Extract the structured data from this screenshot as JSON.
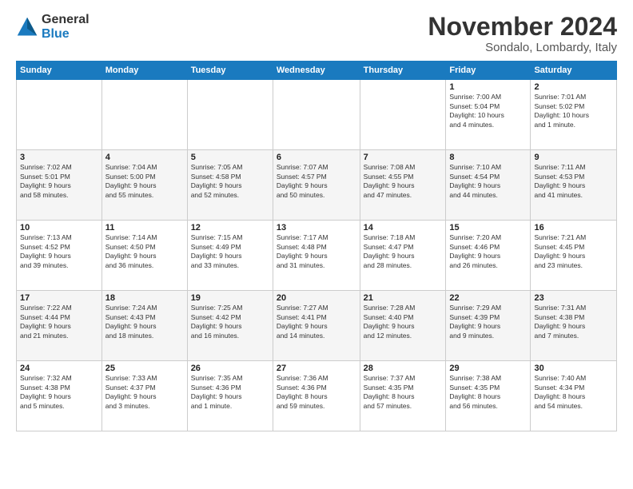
{
  "logo": {
    "general": "General",
    "blue": "Blue"
  },
  "title": "November 2024",
  "location": "Sondalo, Lombardy, Italy",
  "headers": [
    "Sunday",
    "Monday",
    "Tuesday",
    "Wednesday",
    "Thursday",
    "Friday",
    "Saturday"
  ],
  "weeks": [
    [
      {
        "day": "",
        "info": ""
      },
      {
        "day": "",
        "info": ""
      },
      {
        "day": "",
        "info": ""
      },
      {
        "day": "",
        "info": ""
      },
      {
        "day": "",
        "info": ""
      },
      {
        "day": "1",
        "info": "Sunrise: 7:00 AM\nSunset: 5:04 PM\nDaylight: 10 hours\nand 4 minutes."
      },
      {
        "day": "2",
        "info": "Sunrise: 7:01 AM\nSunset: 5:02 PM\nDaylight: 10 hours\nand 1 minute."
      }
    ],
    [
      {
        "day": "3",
        "info": "Sunrise: 7:02 AM\nSunset: 5:01 PM\nDaylight: 9 hours\nand 58 minutes."
      },
      {
        "day": "4",
        "info": "Sunrise: 7:04 AM\nSunset: 5:00 PM\nDaylight: 9 hours\nand 55 minutes."
      },
      {
        "day": "5",
        "info": "Sunrise: 7:05 AM\nSunset: 4:58 PM\nDaylight: 9 hours\nand 52 minutes."
      },
      {
        "day": "6",
        "info": "Sunrise: 7:07 AM\nSunset: 4:57 PM\nDaylight: 9 hours\nand 50 minutes."
      },
      {
        "day": "7",
        "info": "Sunrise: 7:08 AM\nSunset: 4:55 PM\nDaylight: 9 hours\nand 47 minutes."
      },
      {
        "day": "8",
        "info": "Sunrise: 7:10 AM\nSunset: 4:54 PM\nDaylight: 9 hours\nand 44 minutes."
      },
      {
        "day": "9",
        "info": "Sunrise: 7:11 AM\nSunset: 4:53 PM\nDaylight: 9 hours\nand 41 minutes."
      }
    ],
    [
      {
        "day": "10",
        "info": "Sunrise: 7:13 AM\nSunset: 4:52 PM\nDaylight: 9 hours\nand 39 minutes."
      },
      {
        "day": "11",
        "info": "Sunrise: 7:14 AM\nSunset: 4:50 PM\nDaylight: 9 hours\nand 36 minutes."
      },
      {
        "day": "12",
        "info": "Sunrise: 7:15 AM\nSunset: 4:49 PM\nDaylight: 9 hours\nand 33 minutes."
      },
      {
        "day": "13",
        "info": "Sunrise: 7:17 AM\nSunset: 4:48 PM\nDaylight: 9 hours\nand 31 minutes."
      },
      {
        "day": "14",
        "info": "Sunrise: 7:18 AM\nSunset: 4:47 PM\nDaylight: 9 hours\nand 28 minutes."
      },
      {
        "day": "15",
        "info": "Sunrise: 7:20 AM\nSunset: 4:46 PM\nDaylight: 9 hours\nand 26 minutes."
      },
      {
        "day": "16",
        "info": "Sunrise: 7:21 AM\nSunset: 4:45 PM\nDaylight: 9 hours\nand 23 minutes."
      }
    ],
    [
      {
        "day": "17",
        "info": "Sunrise: 7:22 AM\nSunset: 4:44 PM\nDaylight: 9 hours\nand 21 minutes."
      },
      {
        "day": "18",
        "info": "Sunrise: 7:24 AM\nSunset: 4:43 PM\nDaylight: 9 hours\nand 18 minutes."
      },
      {
        "day": "19",
        "info": "Sunrise: 7:25 AM\nSunset: 4:42 PM\nDaylight: 9 hours\nand 16 minutes."
      },
      {
        "day": "20",
        "info": "Sunrise: 7:27 AM\nSunset: 4:41 PM\nDaylight: 9 hours\nand 14 minutes."
      },
      {
        "day": "21",
        "info": "Sunrise: 7:28 AM\nSunset: 4:40 PM\nDaylight: 9 hours\nand 12 minutes."
      },
      {
        "day": "22",
        "info": "Sunrise: 7:29 AM\nSunset: 4:39 PM\nDaylight: 9 hours\nand 9 minutes."
      },
      {
        "day": "23",
        "info": "Sunrise: 7:31 AM\nSunset: 4:38 PM\nDaylight: 9 hours\nand 7 minutes."
      }
    ],
    [
      {
        "day": "24",
        "info": "Sunrise: 7:32 AM\nSunset: 4:38 PM\nDaylight: 9 hours\nand 5 minutes."
      },
      {
        "day": "25",
        "info": "Sunrise: 7:33 AM\nSunset: 4:37 PM\nDaylight: 9 hours\nand 3 minutes."
      },
      {
        "day": "26",
        "info": "Sunrise: 7:35 AM\nSunset: 4:36 PM\nDaylight: 9 hours\nand 1 minute."
      },
      {
        "day": "27",
        "info": "Sunrise: 7:36 AM\nSunset: 4:36 PM\nDaylight: 8 hours\nand 59 minutes."
      },
      {
        "day": "28",
        "info": "Sunrise: 7:37 AM\nSunset: 4:35 PM\nDaylight: 8 hours\nand 57 minutes."
      },
      {
        "day": "29",
        "info": "Sunrise: 7:38 AM\nSunset: 4:35 PM\nDaylight: 8 hours\nand 56 minutes."
      },
      {
        "day": "30",
        "info": "Sunrise: 7:40 AM\nSunset: 4:34 PM\nDaylight: 8 hours\nand 54 minutes."
      }
    ]
  ]
}
